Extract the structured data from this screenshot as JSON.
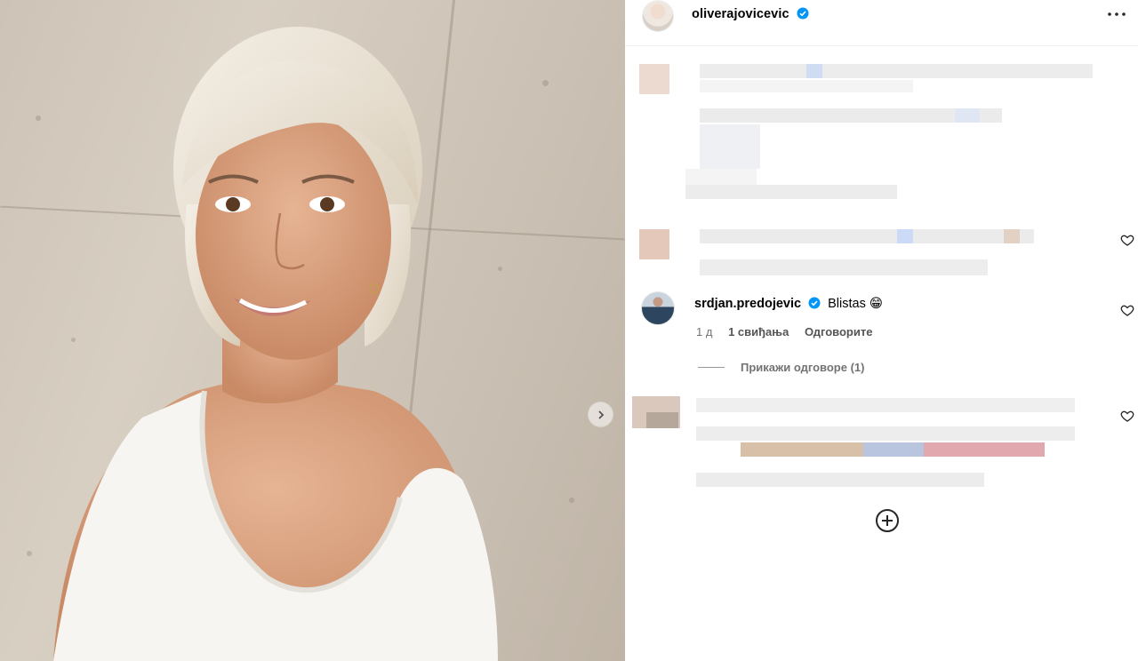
{
  "post": {
    "owner_username": "oliverajovicevic",
    "owner_verified": true,
    "more_icon": "more-horizontal-icon",
    "next_icon": "chevron-right-icon"
  },
  "comments": [
    {
      "username": "srdjan.predojevic",
      "verified": true,
      "text": "Blistas",
      "emoji": "😁",
      "time": "1 д",
      "likes": "1 свиђања",
      "reply_label": "Одговорите",
      "view_replies_label": "Прикажи одговоре (1)"
    }
  ],
  "icons": {
    "like": "heart-icon",
    "add": "plus-circle-icon",
    "verified": "verified-badge-icon"
  },
  "colors": {
    "verified_blue": "#0095f6",
    "meta_gray": "#737373",
    "divider": "#efefef"
  }
}
